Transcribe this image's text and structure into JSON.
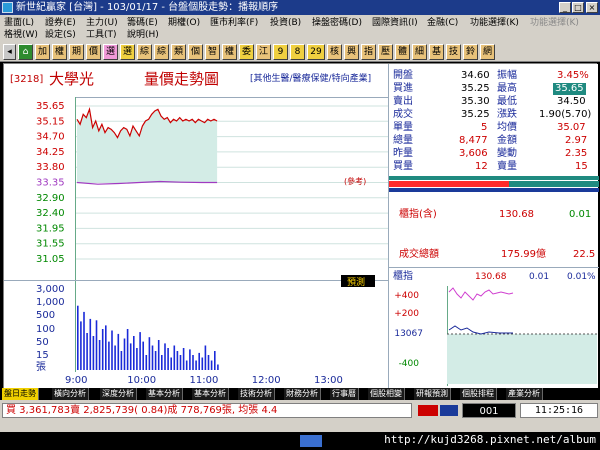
{
  "window": {
    "title": "新世紀贏家 [台灣] - 103/01/17 - 台盤個股走勢：播報順序",
    "min_glyph": "_",
    "max_glyph": "□",
    "close_glyph": "×"
  },
  "menu": {
    "row1": [
      "畫面(L)",
      "證券(E)",
      "主力(U)",
      "籌碼(E)",
      "期權(O)",
      "匯市利率(F)",
      "投資(B)",
      "操盤密碼(D)",
      "國際資訊(I)",
      "金融(C)",
      "功能選擇(K)",
      "功能選擇(K)"
    ],
    "row2": [
      "格視(W)",
      "設定(S)",
      "工具(T)",
      "說明(H)"
    ]
  },
  "toolbar": {
    "buttons": [
      "加",
      "權",
      "期",
      "價",
      "選",
      "選",
      "綜",
      "綜",
      "類",
      "個",
      "智",
      "權",
      "委",
      "江",
      "9",
      "8",
      "29",
      "核",
      "興",
      "指",
      "壓",
      "體",
      "細",
      "基",
      "技",
      "鈴",
      "網"
    ]
  },
  "stock": {
    "code": "[3218]",
    "name": "大學光",
    "chart_title": "量價走勢圖",
    "category": "[其他生醫/醫療保健/特向產業]",
    "ref_tag": "(參考)",
    "predict": "預測"
  },
  "chart_data": {
    "type": "line",
    "title": "量價走勢圖",
    "price_ticks": [
      "35.65",
      "35.15",
      "34.70",
      "34.25",
      "33.80",
      "33.35",
      "32.90",
      "32.40",
      "31.95",
      "31.55",
      "31.05"
    ],
    "reference_price": 33.35,
    "ylim": [
      31.05,
      35.65
    ],
    "volume_ticks": [
      "3,000",
      "1,000",
      "500",
      "100",
      "50",
      "15",
      "張"
    ],
    "time_ticks": [
      "9:00",
      "10:00",
      "11:00",
      "12:00",
      "13:00"
    ],
    "price_series": [
      [
        0,
        35.25
      ],
      [
        3,
        35.1
      ],
      [
        6,
        35.4
      ],
      [
        9,
        35.3
      ],
      [
        12,
        35.55
      ],
      [
        15,
        35.0
      ],
      [
        18,
        35.2
      ],
      [
        21,
        34.9
      ],
      [
        24,
        35.1
      ],
      [
        27,
        34.85
      ],
      [
        30,
        35.0
      ],
      [
        33,
        34.95
      ],
      [
        36,
        34.85
      ],
      [
        39,
        34.7
      ],
      [
        42,
        34.9
      ],
      [
        45,
        35.0
      ],
      [
        48,
        34.95
      ],
      [
        51,
        34.75
      ],
      [
        54,
        35.05
      ],
      [
        57,
        34.9
      ],
      [
        60,
        34.75
      ],
      [
        63,
        35.05
      ],
      [
        66,
        35.2
      ],
      [
        69,
        35.25
      ],
      [
        72,
        35.4
      ],
      [
        75,
        35.5
      ],
      [
        78,
        35.55
      ],
      [
        81,
        35.35
      ],
      [
        84,
        35.25
      ],
      [
        87,
        35.3
      ],
      [
        90,
        35.15
      ],
      [
        93,
        35.25
      ],
      [
        96,
        35.2
      ],
      [
        99,
        35.3
      ],
      [
        102,
        35.2
      ],
      [
        105,
        35.25
      ],
      [
        108,
        35.2
      ],
      [
        111,
        35.25
      ],
      [
        114,
        35.15
      ],
      [
        117,
        35.25
      ],
      [
        120,
        35.2
      ],
      [
        123,
        35.15
      ],
      [
        126,
        35.25
      ],
      [
        129,
        35.2
      ],
      [
        132,
        35.25
      ],
      [
        135,
        35.2
      ]
    ],
    "avg_series": [
      [
        0,
        33.35
      ],
      [
        20,
        33.3
      ],
      [
        40,
        33.32
      ],
      [
        60,
        33.35
      ],
      [
        80,
        33.38
      ],
      [
        100,
        33.36
      ],
      [
        120,
        33.35
      ],
      [
        135,
        33.35
      ]
    ],
    "volume_series": [
      1100,
      350,
      700,
      150,
      420,
      120,
      380,
      90,
      200,
      260,
      80,
      180,
      60,
      140,
      40,
      100,
      200,
      70,
      120,
      50,
      160,
      80,
      30,
      110,
      60,
      40,
      90,
      30,
      70,
      50,
      25,
      60,
      40,
      30,
      50,
      20,
      45,
      30,
      20,
      35,
      25,
      60,
      30,
      20,
      40,
      15
    ]
  },
  "quote": {
    "open": {
      "label": "開盤",
      "value": "34.60"
    },
    "amplitude": {
      "label": "振幅",
      "value": "3.45%"
    },
    "bid": {
      "label": "買進",
      "value": "35.25"
    },
    "high": {
      "label": "最高",
      "value": "35.65"
    },
    "ask": {
      "label": "賣出",
      "value": "35.30"
    },
    "low": {
      "label": "最低",
      "value": "34.50"
    },
    "deal": {
      "label": "成交",
      "value": "35.25"
    },
    "change": {
      "label": "漲跌",
      "value": "1.90(5.70)"
    },
    "unit_vol": {
      "label": "單量",
      "value": "5"
    },
    "avg_price": {
      "label": "均價",
      "value": "35.07"
    },
    "total_vol": {
      "label": "總量",
      "value": "8,477"
    },
    "amount": {
      "label": "金額",
      "value": "2.97"
    },
    "yest_vol": {
      "label": "昨量",
      "value": "3,606"
    },
    "turnover": {
      "label": "變動",
      "value": "2.35"
    },
    "buy_vol": {
      "label": "買量",
      "value": "12"
    },
    "sell_vol": {
      "label": "賣量",
      "value": "15"
    }
  },
  "index": {
    "label": "櫃指(含)",
    "value": "130.68",
    "change": "0.01",
    "total_label": "成交總額",
    "total_value": "175.99億",
    "total_extra": "22.5",
    "mini_label": "櫃指",
    "mini_value": "130.68",
    "mini_change": "0.01",
    "mini_pct": "0.01%",
    "tick_up": "+400",
    "tick_mid": "+200",
    "tick_base": "13067",
    "tick_down": "-400"
  },
  "tabs": [
    "盤日走勢",
    "橫向分析",
    "深度分析",
    "基本分析",
    "基本分析",
    "技術分析",
    "財務分析",
    "行事曆",
    "個股相變",
    "研報預測",
    "個股排程",
    "產業分析"
  ],
  "status": {
    "line": "買 3,361,783賣 2,825,739( 0.84)成 778,769張, 均張 4.4",
    "counter": "001",
    "clock": "11:25:16"
  },
  "footer": {
    "url": "http://kujd3268.pixnet.net/album"
  }
}
